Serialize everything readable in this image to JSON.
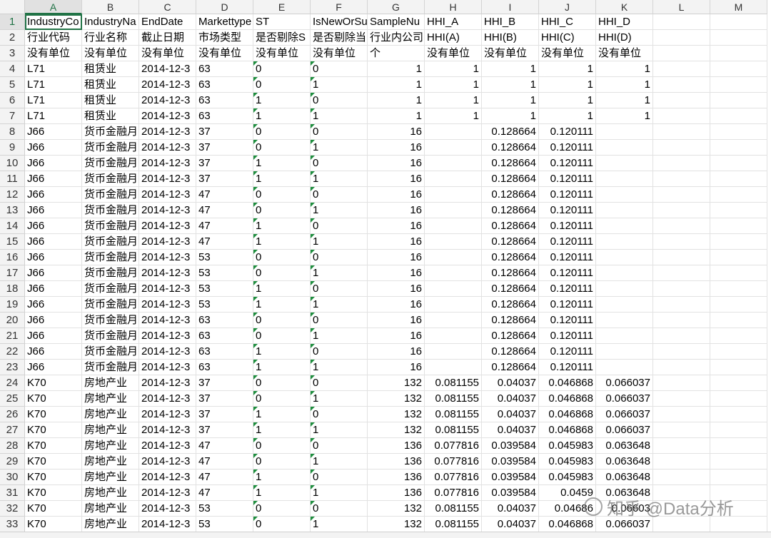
{
  "columns": [
    "A",
    "B",
    "C",
    "D",
    "E",
    "F",
    "G",
    "H",
    "I",
    "J",
    "K",
    "L",
    "M"
  ],
  "rows": [
    {
      "n": "1",
      "c": [
        "IndustryCo",
        "IndustryNa",
        "EndDate",
        "Markettype",
        "ST",
        "IsNewOrSu",
        "SampleNu",
        "HHI_A",
        "HHI_B",
        "HHI_C",
        "HHI_D",
        "",
        ""
      ]
    },
    {
      "n": "2",
      "c": [
        "行业代码",
        "行业名称",
        "截止日期",
        "市场类型",
        "是否剔除S",
        "是否剔除当",
        "行业内公司",
        "HHI(A)",
        "HHI(B)",
        "HHI(C)",
        "HHI(D)",
        "",
        ""
      ]
    },
    {
      "n": "3",
      "c": [
        "没有单位",
        "没有单位",
        "没有单位",
        "没有单位",
        "没有单位",
        "没有单位",
        "个",
        "没有单位",
        "没有单位",
        "没有单位",
        "没有单位",
        "",
        ""
      ]
    },
    {
      "n": "4",
      "c": [
        "L71",
        "租赁业",
        "2014-12-3",
        "63",
        "0",
        "0",
        "1",
        "1",
        "1",
        "1",
        "1",
        "",
        ""
      ]
    },
    {
      "n": "5",
      "c": [
        "L71",
        "租赁业",
        "2014-12-3",
        "63",
        "0",
        "1",
        "1",
        "1",
        "1",
        "1",
        "1",
        "",
        ""
      ]
    },
    {
      "n": "6",
      "c": [
        "L71",
        "租赁业",
        "2014-12-3",
        "63",
        "1",
        "0",
        "1",
        "1",
        "1",
        "1",
        "1",
        "",
        ""
      ]
    },
    {
      "n": "7",
      "c": [
        "L71",
        "租赁业",
        "2014-12-3",
        "63",
        "1",
        "1",
        "1",
        "1",
        "1",
        "1",
        "1",
        "",
        ""
      ]
    },
    {
      "n": "8",
      "c": [
        "J66",
        "货币金融月",
        "2014-12-3",
        "37",
        "0",
        "0",
        "16",
        "",
        "0.128664",
        "0.120111",
        "",
        "",
        ""
      ]
    },
    {
      "n": "9",
      "c": [
        "J66",
        "货币金融月",
        "2014-12-3",
        "37",
        "0",
        "1",
        "16",
        "",
        "0.128664",
        "0.120111",
        "",
        "",
        ""
      ]
    },
    {
      "n": "10",
      "c": [
        "J66",
        "货币金融月",
        "2014-12-3",
        "37",
        "1",
        "0",
        "16",
        "",
        "0.128664",
        "0.120111",
        "",
        "",
        ""
      ]
    },
    {
      "n": "11",
      "c": [
        "J66",
        "货币金融月",
        "2014-12-3",
        "37",
        "1",
        "1",
        "16",
        "",
        "0.128664",
        "0.120111",
        "",
        "",
        ""
      ]
    },
    {
      "n": "12",
      "c": [
        "J66",
        "货币金融月",
        "2014-12-3",
        "47",
        "0",
        "0",
        "16",
        "",
        "0.128664",
        "0.120111",
        "",
        "",
        ""
      ]
    },
    {
      "n": "13",
      "c": [
        "J66",
        "货币金融月",
        "2014-12-3",
        "47",
        "0",
        "1",
        "16",
        "",
        "0.128664",
        "0.120111",
        "",
        "",
        ""
      ]
    },
    {
      "n": "14",
      "c": [
        "J66",
        "货币金融月",
        "2014-12-3",
        "47",
        "1",
        "0",
        "16",
        "",
        "0.128664",
        "0.120111",
        "",
        "",
        ""
      ]
    },
    {
      "n": "15",
      "c": [
        "J66",
        "货币金融月",
        "2014-12-3",
        "47",
        "1",
        "1",
        "16",
        "",
        "0.128664",
        "0.120111",
        "",
        "",
        ""
      ]
    },
    {
      "n": "16",
      "c": [
        "J66",
        "货币金融月",
        "2014-12-3",
        "53",
        "0",
        "0",
        "16",
        "",
        "0.128664",
        "0.120111",
        "",
        "",
        ""
      ]
    },
    {
      "n": "17",
      "c": [
        "J66",
        "货币金融月",
        "2014-12-3",
        "53",
        "0",
        "1",
        "16",
        "",
        "0.128664",
        "0.120111",
        "",
        "",
        ""
      ]
    },
    {
      "n": "18",
      "c": [
        "J66",
        "货币金融月",
        "2014-12-3",
        "53",
        "1",
        "0",
        "16",
        "",
        "0.128664",
        "0.120111",
        "",
        "",
        ""
      ]
    },
    {
      "n": "19",
      "c": [
        "J66",
        "货币金融月",
        "2014-12-3",
        "53",
        "1",
        "1",
        "16",
        "",
        "0.128664",
        "0.120111",
        "",
        "",
        ""
      ]
    },
    {
      "n": "20",
      "c": [
        "J66",
        "货币金融月",
        "2014-12-3",
        "63",
        "0",
        "0",
        "16",
        "",
        "0.128664",
        "0.120111",
        "",
        "",
        ""
      ]
    },
    {
      "n": "21",
      "c": [
        "J66",
        "货币金融月",
        "2014-12-3",
        "63",
        "0",
        "1",
        "16",
        "",
        "0.128664",
        "0.120111",
        "",
        "",
        ""
      ]
    },
    {
      "n": "22",
      "c": [
        "J66",
        "货币金融月",
        "2014-12-3",
        "63",
        "1",
        "0",
        "16",
        "",
        "0.128664",
        "0.120111",
        "",
        "",
        ""
      ]
    },
    {
      "n": "23",
      "c": [
        "J66",
        "货币金融月",
        "2014-12-3",
        "63",
        "1",
        "1",
        "16",
        "",
        "0.128664",
        "0.120111",
        "",
        "",
        ""
      ]
    },
    {
      "n": "24",
      "c": [
        "K70",
        "房地产业",
        "2014-12-3",
        "37",
        "0",
        "0",
        "132",
        "0.081155",
        "0.04037",
        "0.046868",
        "0.066037",
        "",
        ""
      ]
    },
    {
      "n": "25",
      "c": [
        "K70",
        "房地产业",
        "2014-12-3",
        "37",
        "0",
        "1",
        "132",
        "0.081155",
        "0.04037",
        "0.046868",
        "0.066037",
        "",
        ""
      ]
    },
    {
      "n": "26",
      "c": [
        "K70",
        "房地产业",
        "2014-12-3",
        "37",
        "1",
        "0",
        "132",
        "0.081155",
        "0.04037",
        "0.046868",
        "0.066037",
        "",
        ""
      ]
    },
    {
      "n": "27",
      "c": [
        "K70",
        "房地产业",
        "2014-12-3",
        "37",
        "1",
        "1",
        "132",
        "0.081155",
        "0.04037",
        "0.046868",
        "0.066037",
        "",
        ""
      ]
    },
    {
      "n": "28",
      "c": [
        "K70",
        "房地产业",
        "2014-12-3",
        "47",
        "0",
        "0",
        "136",
        "0.077816",
        "0.039584",
        "0.045983",
        "0.063648",
        "",
        ""
      ]
    },
    {
      "n": "29",
      "c": [
        "K70",
        "房地产业",
        "2014-12-3",
        "47",
        "0",
        "1",
        "136",
        "0.077816",
        "0.039584",
        "0.045983",
        "0.063648",
        "",
        ""
      ]
    },
    {
      "n": "30",
      "c": [
        "K70",
        "房地产业",
        "2014-12-3",
        "47",
        "1",
        "0",
        "136",
        "0.077816",
        "0.039584",
        "0.045983",
        "0.063648",
        "",
        ""
      ]
    },
    {
      "n": "31",
      "c": [
        "K70",
        "房地产业",
        "2014-12-3",
        "47",
        "1",
        "1",
        "136",
        "0.077816",
        "0.039584",
        "0.0459",
        "0.063648",
        "",
        ""
      ]
    },
    {
      "n": "32",
      "c": [
        "K70",
        "房地产业",
        "2014-12-3",
        "53",
        "0",
        "0",
        "132",
        "0.081155",
        "0.04037",
        "0.04686",
        "0.06603",
        "",
        ""
      ]
    },
    {
      "n": "33",
      "c": [
        "K70",
        "房地产业",
        "2014-12-3",
        "53",
        "0",
        "1",
        "132",
        "0.081155",
        "0.04037",
        "0.046868",
        "0.066037",
        "",
        ""
      ]
    }
  ],
  "watermark": {
    "text": "知乎 @Data分析",
    "logo_icon": "wechat-logo-icon"
  },
  "colors": {
    "accent": "#217346",
    "flag": "#1e8e3e"
  }
}
